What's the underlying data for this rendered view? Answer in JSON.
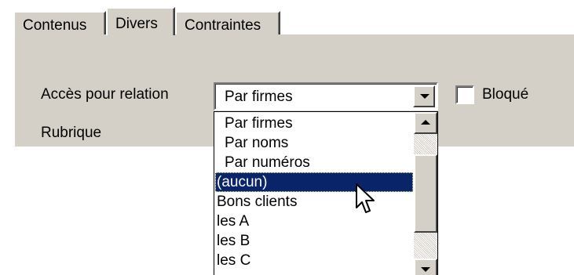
{
  "tabs": [
    {
      "label": "Contenus",
      "active": false
    },
    {
      "label": "Divers",
      "active": true
    },
    {
      "label": "Contraintes",
      "active": false
    }
  ],
  "form": {
    "access_label": "Accès pour relation",
    "rubrique_label": "Rubrique",
    "combo_value": "Par firmes",
    "checkbox_label": "Bloqué",
    "checkbox_checked": false
  },
  "dropdown": {
    "items": [
      "Par firmes",
      "Par noms",
      "Par numéros",
      "(aucun)",
      "Bons clients",
      "les A",
      "les B",
      "les C"
    ],
    "selected_index": 3
  },
  "icons": {
    "combo_button": "chevron-down-icon",
    "scroll_up": "arrow-up-icon",
    "scroll_down": "arrow-down-icon",
    "cursor": "mouse-pointer-icon"
  },
  "colors": {
    "face": "#d4d0c8",
    "selection": "#0a246a",
    "window": "#ffffff"
  }
}
